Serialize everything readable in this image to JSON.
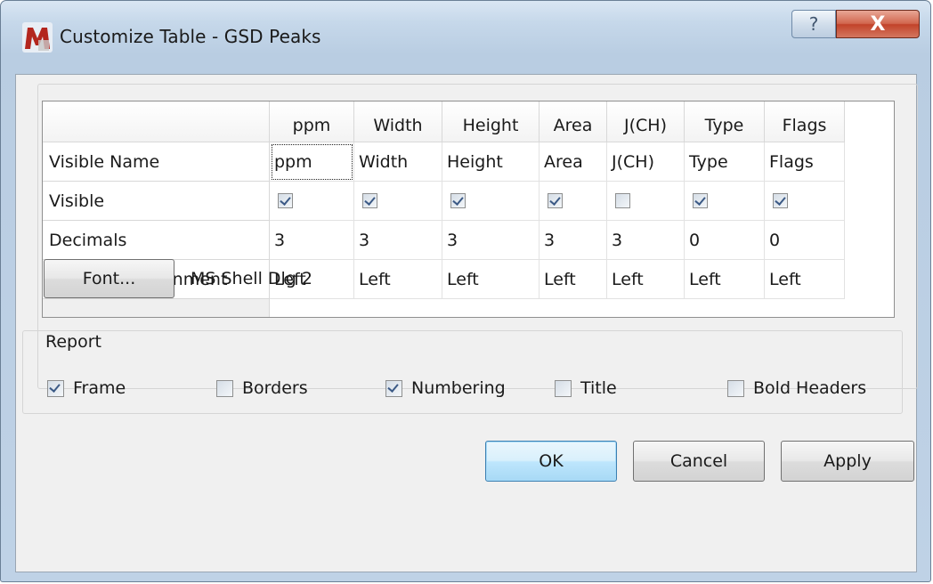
{
  "window": {
    "title": "Customize Table - GSD Peaks",
    "help_glyph": "?",
    "close_glyph": "X"
  },
  "table": {
    "columns": [
      "ppm",
      "Width",
      "Height",
      "Area",
      "J(CH)",
      "Type",
      "Flags"
    ],
    "row_labels": [
      "Visible Name",
      "Visible",
      "Decimals",
      "Horizontal Alignment"
    ],
    "visible_names": [
      "ppm",
      "Width",
      "Height",
      "Area",
      "J(CH)",
      "Type",
      "Flags"
    ],
    "visible": [
      true,
      true,
      true,
      true,
      false,
      true,
      true
    ],
    "decimals": [
      "3",
      "3",
      "3",
      "3",
      "3",
      "0",
      "0"
    ],
    "alignment": [
      "Left",
      "Left",
      "Left",
      "Left",
      "Left",
      "Left",
      "Left"
    ]
  },
  "font": {
    "button_label": "Font...",
    "current_font": "MS Shell Dlg 2"
  },
  "report": {
    "label": "Report",
    "options": [
      {
        "label": "Frame",
        "checked": true
      },
      {
        "label": "Borders",
        "checked": false
      },
      {
        "label": "Numbering",
        "checked": true
      },
      {
        "label": "Title",
        "checked": false
      },
      {
        "label": "Bold Headers",
        "checked": false
      }
    ]
  },
  "buttons": {
    "ok": "OK",
    "cancel": "Cancel",
    "apply": "Apply"
  }
}
